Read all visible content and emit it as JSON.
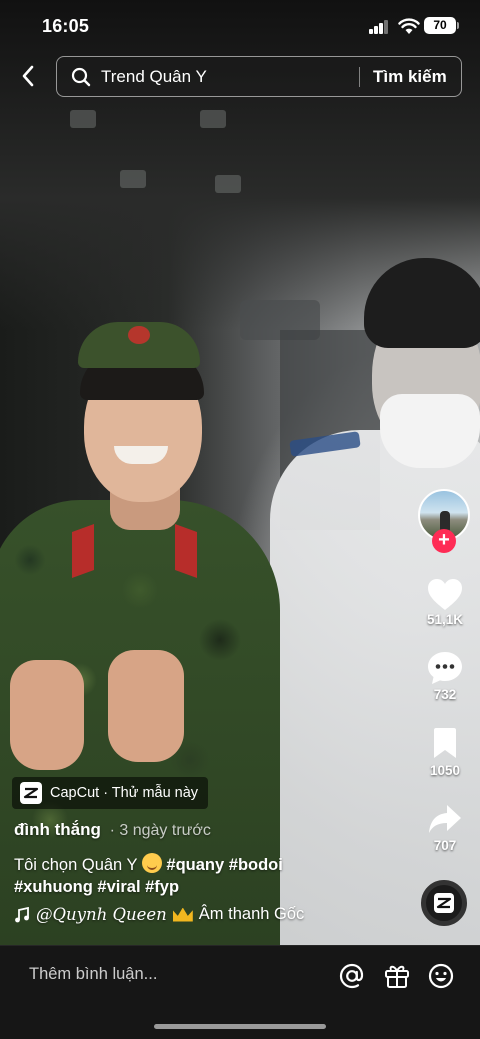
{
  "status_bar": {
    "time": "16:05",
    "battery": "70"
  },
  "search": {
    "query": "Trend Quân Y",
    "button_label": "Tìm kiếm"
  },
  "video": {
    "effect_tag": "CapCut · Thử mẫu này",
    "author": "đình thắng",
    "posted": "· 3 ngày trước",
    "caption_text": "Tôi chọn Quân Y",
    "hashtags_line1": "#quany #bodoi",
    "hashtags_line2": "#xuhuong #viral #fyp",
    "sound_user": "@𝑄𝑢𝑦𝑛ℎ 𝑄𝑢𝑒𝑒𝑛",
    "sound_title": "Âm thanh Gốc"
  },
  "actions": {
    "likes": "51,1K",
    "comments": "732",
    "saves": "1050",
    "shares": "707"
  },
  "comment_bar": {
    "placeholder": "Thêm bình luận..."
  },
  "colors": {
    "accent": "#fe2c55",
    "bottom_bar": "#161616"
  }
}
